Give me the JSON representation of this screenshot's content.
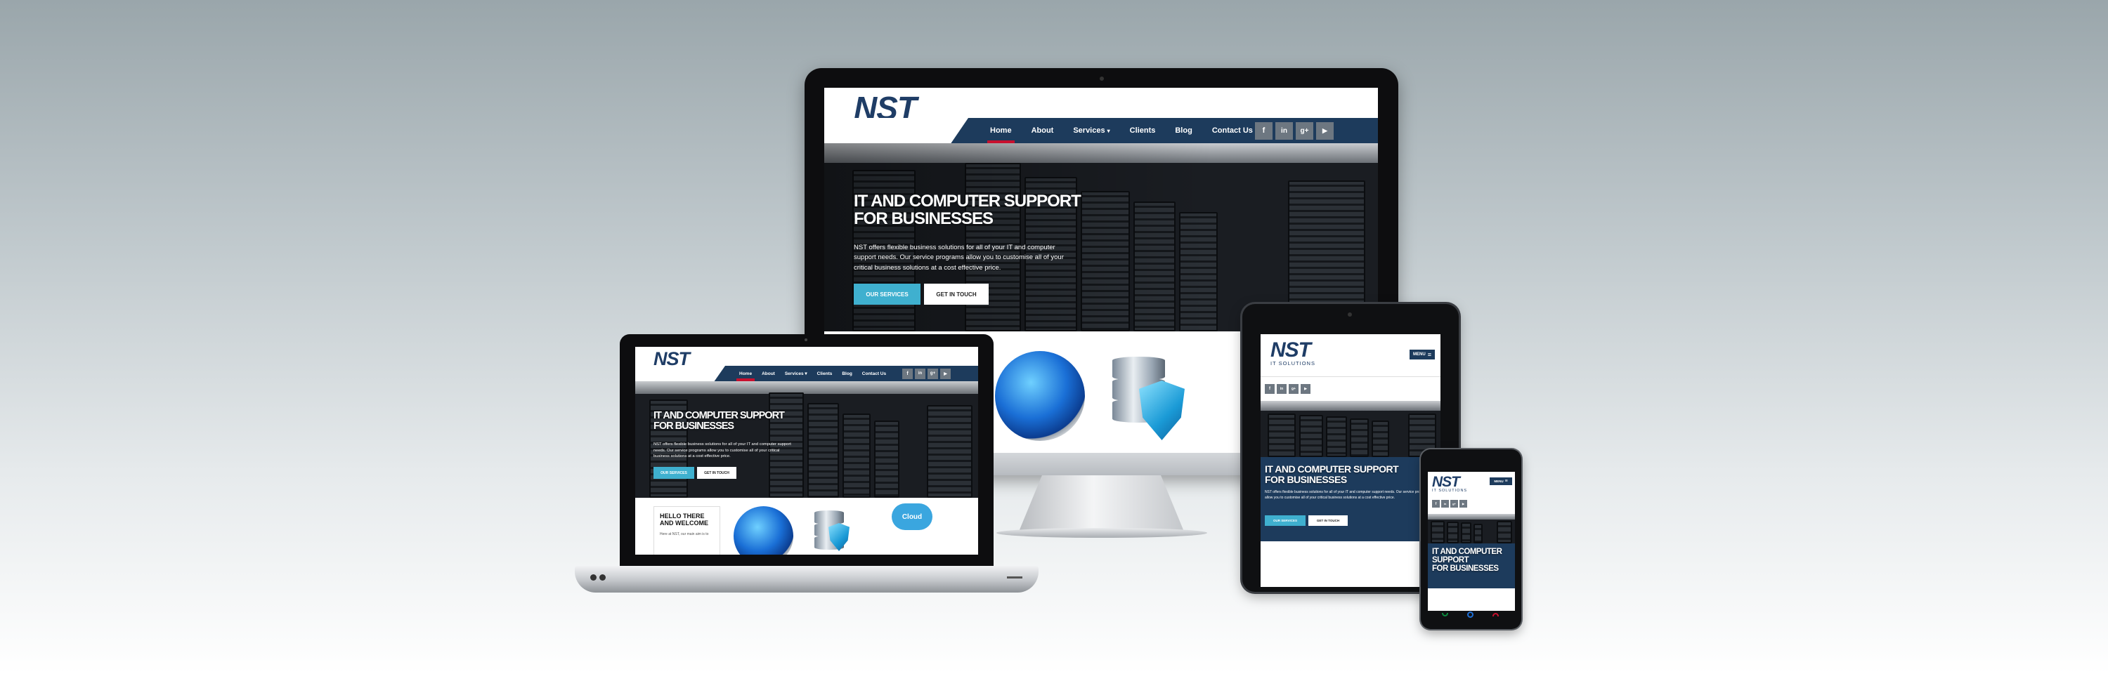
{
  "site": {
    "logo_main": "NST",
    "logo_sub": "IT SOLUTIONS",
    "nav": [
      "Home",
      "About",
      "Services",
      "Clients",
      "Blog",
      "Contact Us"
    ],
    "nav_active": "Home",
    "services_caret": "▾",
    "social_icons": [
      "facebook-icon",
      "linkedin-icon",
      "googleplus-icon",
      "youtube-icon"
    ],
    "social_glyphs": [
      "f",
      "in",
      "g+",
      "▶"
    ],
    "hero_title_line1": "IT AND COMPUTER SUPPORT",
    "hero_title_line2": "FOR BUSINESSES",
    "hero_text": "NST offers flexible business solutions for all of your IT and computer support needs. Our service programs allow you to customise all of your critical business solutions at a cost effective price.",
    "btn_primary": "OUR SERVICES",
    "btn_secondary": "GET IN TOUCH",
    "welcome_line1": "HELLO THERE",
    "welcome_line2": "AND WELCOME",
    "welcome_text": "Here at NST, our main aim is to",
    "cloud_label": "Cloud",
    "menu_label": "MENU",
    "menu_icon": "≡"
  },
  "colors": {
    "brand_navy": "#1d3b5c",
    "accent_cyan": "#3fb0cf",
    "nav_active_red": "#c8102e"
  }
}
